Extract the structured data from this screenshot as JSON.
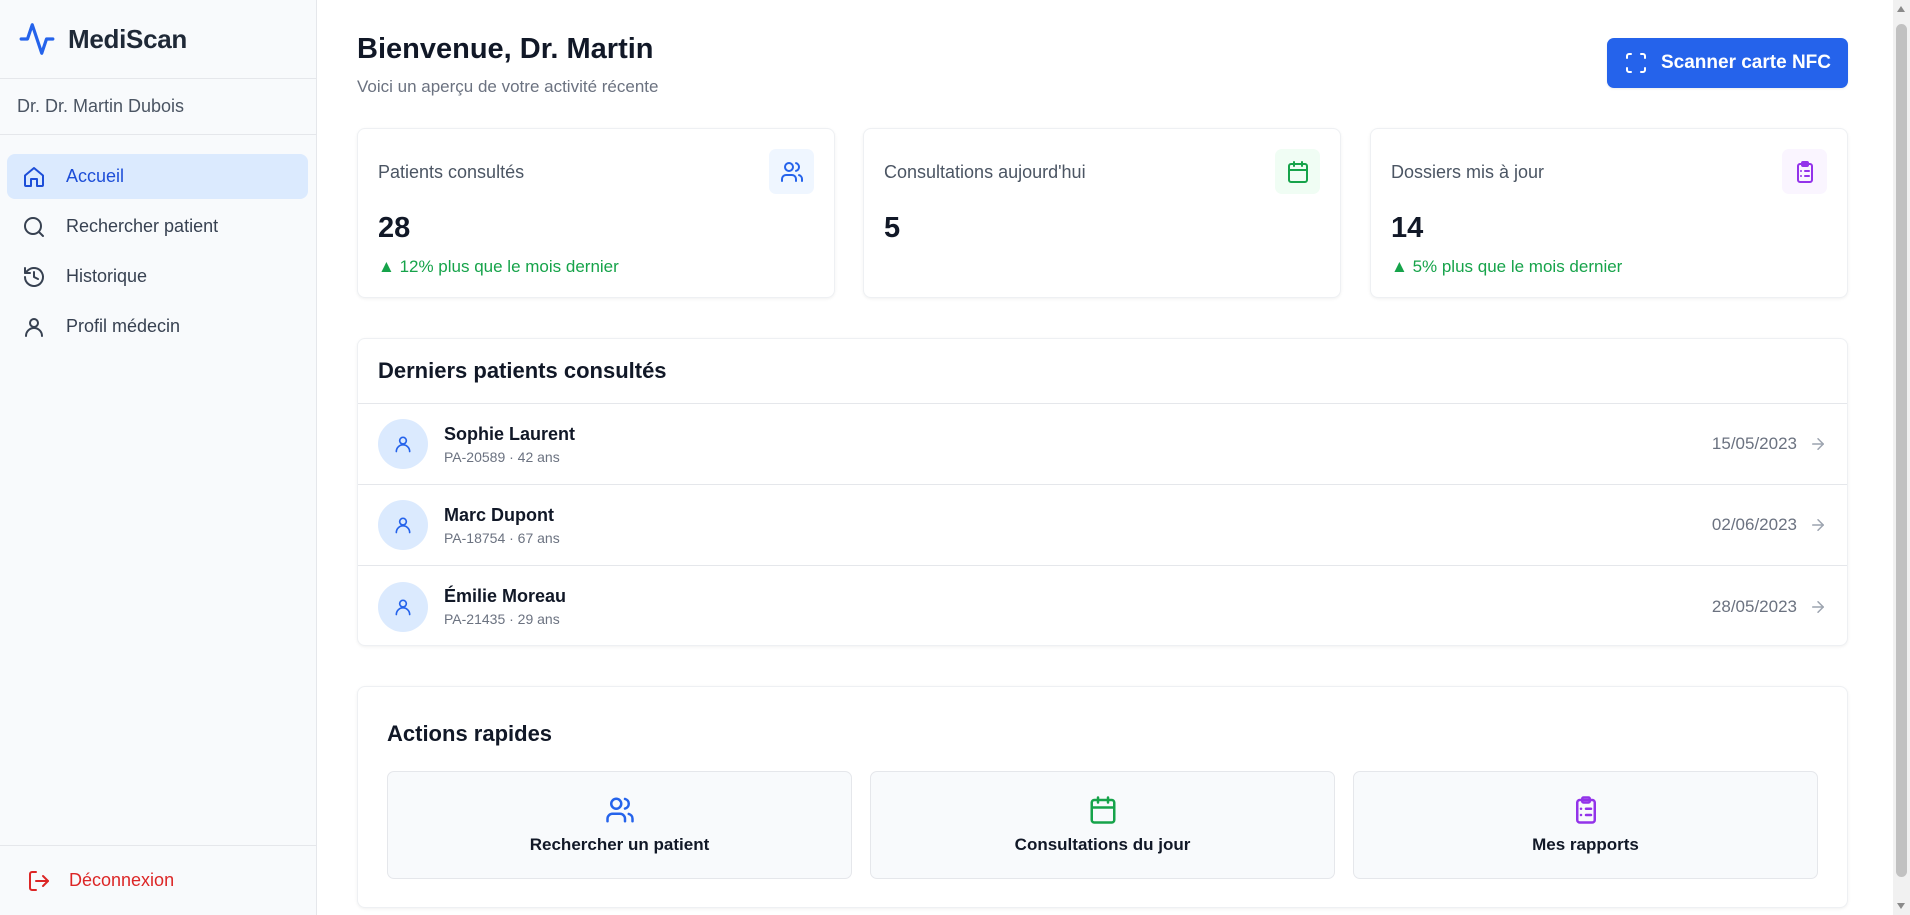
{
  "brand": {
    "name": "MediScan",
    "icon": "activity-icon",
    "color": "#2563eb"
  },
  "doctor": {
    "name": "Dr. Dr. Martin Dubois"
  },
  "nav": {
    "items": [
      {
        "label": "Accueil",
        "icon": "home-icon",
        "active": true
      },
      {
        "label": "Rechercher patient",
        "icon": "search-icon",
        "active": false
      },
      {
        "label": "Historique",
        "icon": "history-icon",
        "active": false
      },
      {
        "label": "Profil médecin",
        "icon": "user-icon",
        "active": false
      }
    ],
    "logout": "Déconnexion"
  },
  "header": {
    "title": "Bienvenue, Dr. Martin",
    "subtitle": "Voici un aperçu de votre activité récente",
    "nfc_button": "Scanner carte NFC"
  },
  "stats": [
    {
      "label": "Patients consultés",
      "value": "28",
      "trend": "12% plus que le mois dernier",
      "icon": "users-icon",
      "color": "#2563eb",
      "bg": "#eff6ff"
    },
    {
      "label": "Consultations aujourd'hui",
      "value": "5",
      "trend": "",
      "icon": "calendar-icon",
      "color": "#16a34a",
      "bg": "#f0fdf4"
    },
    {
      "label": "Dossiers mis à jour",
      "value": "14",
      "trend": "5% plus que le mois dernier",
      "icon": "clipboard-icon",
      "color": "#9333ea",
      "bg": "#faf5ff"
    }
  ],
  "recent": {
    "title": "Derniers patients consultés",
    "patients": [
      {
        "name": "Sophie Laurent",
        "meta": "PA-20589 · 42 ans",
        "date": "15/05/2023"
      },
      {
        "name": "Marc Dupont",
        "meta": "PA-18754 · 67 ans",
        "date": "02/06/2023"
      },
      {
        "name": "Émilie Moreau",
        "meta": "PA-21435 · 29 ans",
        "date": "28/05/2023"
      }
    ]
  },
  "quick": {
    "title": "Actions rapides",
    "actions": [
      {
        "label": "Rechercher un patient",
        "icon": "users-icon",
        "color": "#2563eb"
      },
      {
        "label": "Consultations du jour",
        "icon": "calendar-icon",
        "color": "#16a34a"
      },
      {
        "label": "Mes rapports",
        "icon": "clipboard-icon",
        "color": "#9333ea"
      }
    ]
  }
}
